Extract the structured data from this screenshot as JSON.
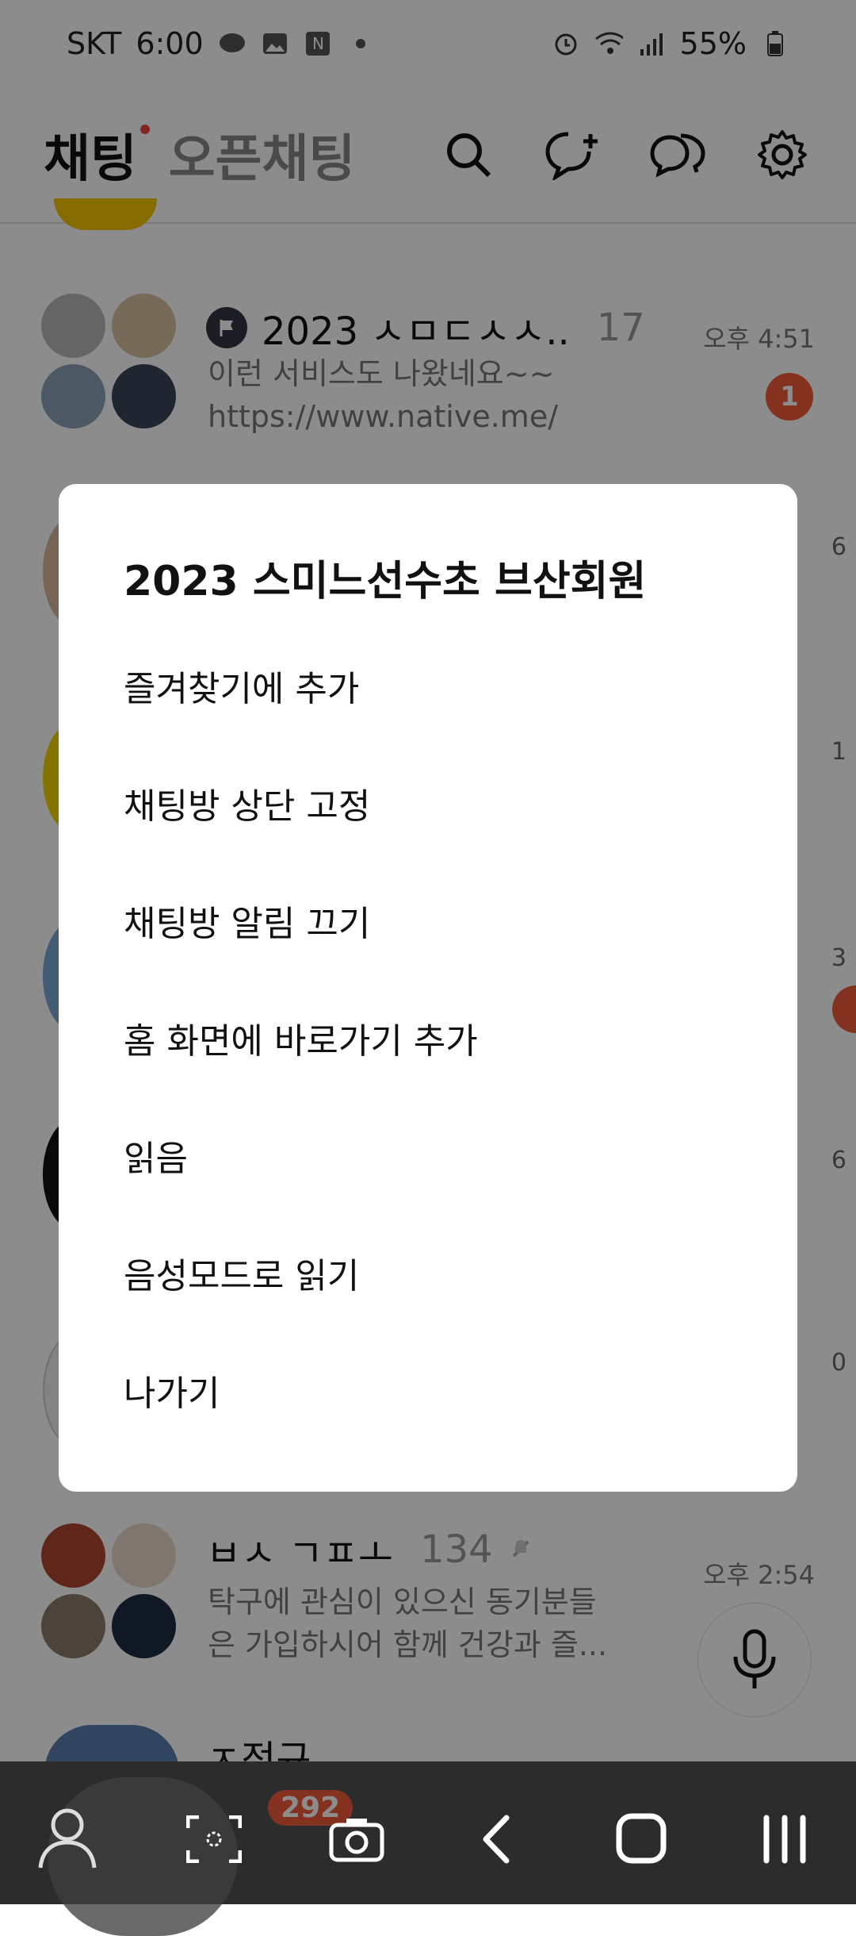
{
  "status": {
    "carrier": "SKT",
    "time": "6:00",
    "battery": "55%"
  },
  "header": {
    "tab_chat": "채팅",
    "tab_open_chat": "오픈채팅"
  },
  "chats": [
    {
      "name": "2023 ㅅㅁㄷㅅㅅ..",
      "member_count": "17",
      "message_line1": "이런 서비스도 나왔네요~~",
      "message_line2": "https://www.native.me/",
      "time": "오후 4:51",
      "unread": "1"
    },
    {
      "name": "ㅂㅅ ㄱㅍㅗ",
      "member_count": "134",
      "message_line1": "탁구에 관심이 있으신 동기분들",
      "message_line2": "은 가입하시어 함께 건강과 즐...",
      "time": "오후 2:54"
    },
    {
      "name": "ㅈ정규"
    }
  ],
  "side_times": [
    "6",
    "1",
    "3",
    "6",
    "0"
  ],
  "dialog": {
    "title": "2023 스미느선수초 브산회원",
    "items": [
      "즐겨찾기에 추가",
      "채팅방 상단 고정",
      "채팅방 알림 끄기",
      "홈 화면에 바로가기 추가",
      "읽음",
      "음성모드로 읽기",
      "나가기"
    ]
  },
  "bottom": {
    "badge_count": "292"
  }
}
